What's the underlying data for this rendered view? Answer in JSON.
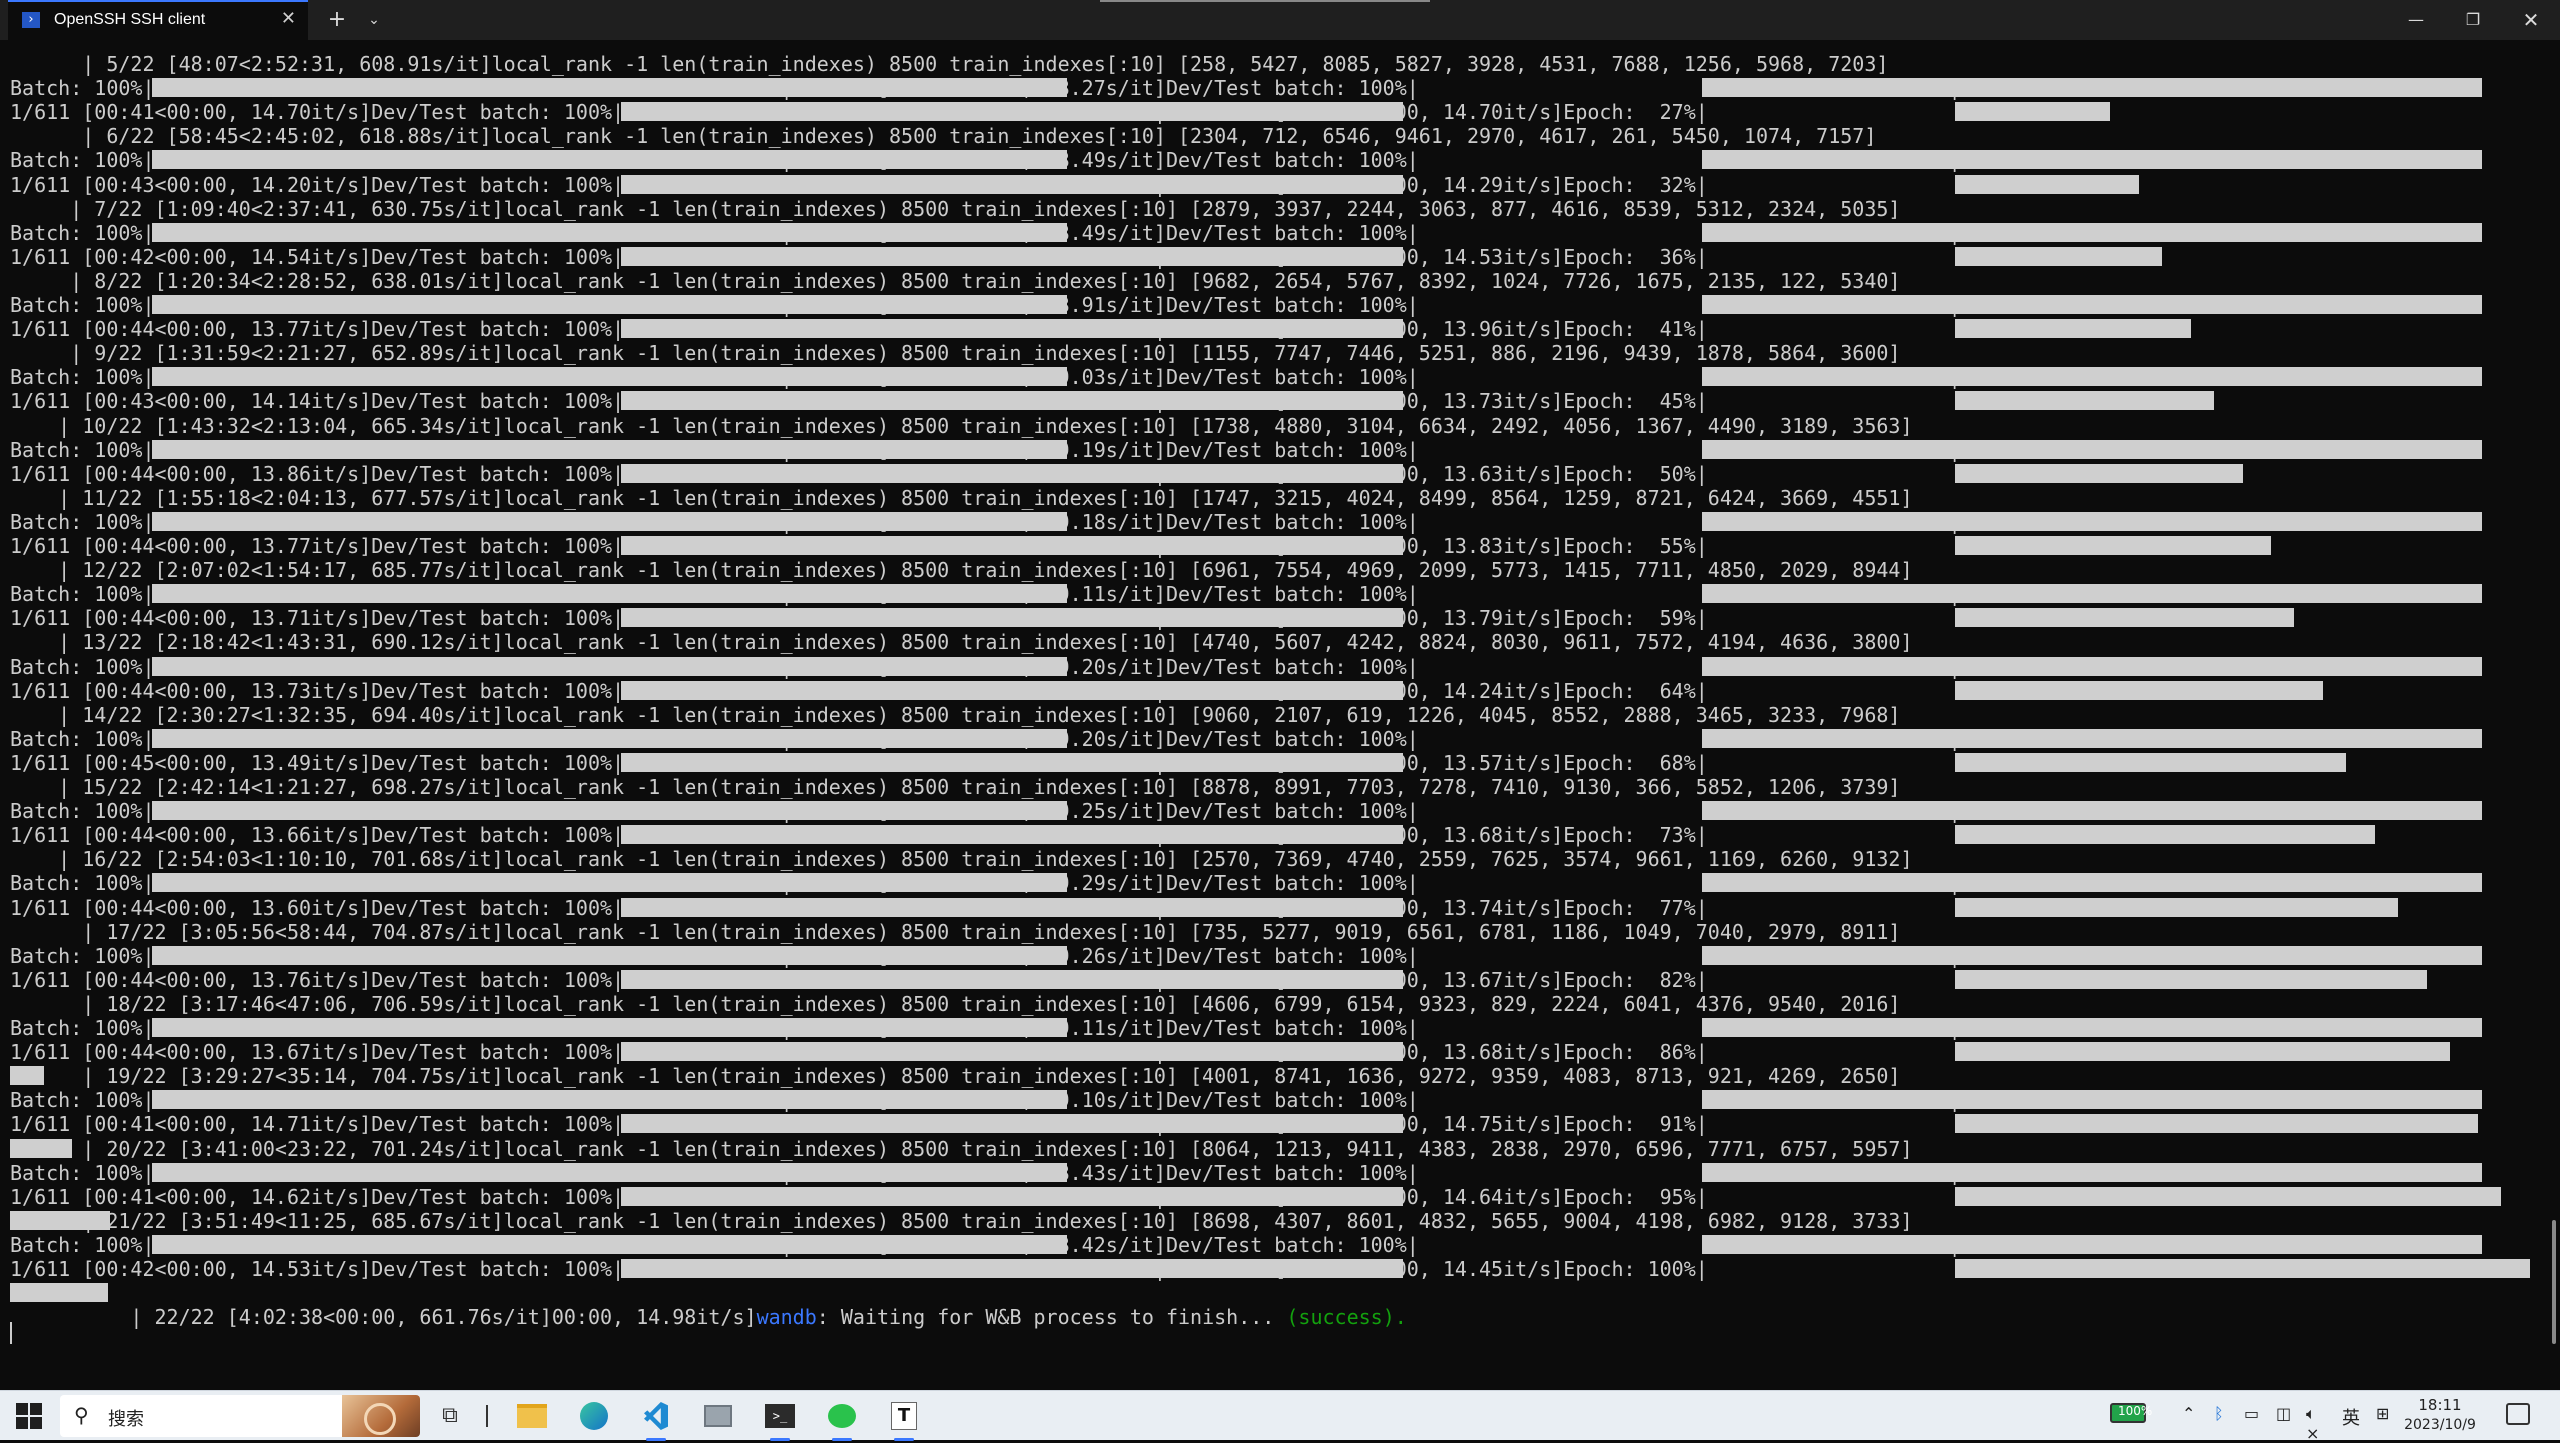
{
  "window": {
    "tab_title": "OpenSSH SSH client",
    "tab_icon": "terminal-icon",
    "new_tab": "+",
    "dropdown": "⌄",
    "minimize": "—",
    "maximize": "❐",
    "close": "✕"
  },
  "terminal": {
    "colors": {
      "text": "#cccccc",
      "background": "#0c0c0c",
      "wandb": "#3b78ff",
      "success": "#13a10e",
      "progress_fill": "#cfcfcf"
    },
    "lines": [
      "      | 5/22 [48:07<2:52:31, 608.91s/it]local_rank -1 len(train_indexes) 8500 train_indexes[:10] [258, 5427, 8085, 5827, 3928, 4531, 7688, 1256, 5968, 7203]",
      "Batch: 100%|                                                    | 67/67 [09:14<00:00,  8.27s/it]Dev/Test batch: 100%|                                            | 61",
      "1/611 [00:41<00:00, 14.70it/s]Dev/Test batch: 100%|                                            | 621/621 [00:42<00:00, 14.70it/s]Epoch:  27%|",
      "      | 6/22 [58:45<2:45:02, 618.88s/it]local_rank -1 len(train_indexes) 8500 train_indexes[:10] [2304, 712, 6546, 9461, 2970, 4617, 261, 5450, 1074, 7157]",
      "Batch: 100%|                                                    | 67/67 [09:28<00:00,  8.49s/it]Dev/Test batch: 100%|                                            | 61",
      "1/611 [00:43<00:00, 14.20it/s]Dev/Test batch: 100%|                                            | 621/621 [00:43<00:00, 14.29it/s]Epoch:  32%|",
      "     | 7/22 [1:09:40<2:37:41, 630.75s/it]local_rank -1 len(train_indexes) 8500 train_indexes[:10] [2879, 3937, 2244, 3063, 877, 4616, 8539, 5312, 2324, 5035]",
      "Batch: 100%|                                                    | 67/67 [09:28<00:00,  8.49s/it]Dev/Test batch: 100%|                                            | 61",
      "1/611 [00:42<00:00, 14.54it/s]Dev/Test batch: 100%|                                            | 621/621 [00:42<00:00, 14.53it/s]Epoch:  36%|",
      "     | 8/22 [1:20:34<2:28:52, 638.01s/it]local_rank -1 len(train_indexes) 8500 train_indexes[:10] [9682, 2654, 5767, 8392, 1024, 7726, 1675, 2135, 122, 5340]",
      "Batch: 100%|                                                    | 67/67 [09:56<00:00,  8.91s/it]Dev/Test batch: 100%|                                            | 61",
      "1/611 [00:44<00:00, 13.77it/s]Dev/Test batch: 100%|                                            | 621/621 [00:44<00:00, 13.96it/s]Epoch:  41%|",
      "     | 9/22 [1:31:59<2:21:27, 652.89s/it]local_rank -1 len(train_indexes) 8500 train_indexes[:10] [1155, 7747, 7446, 5251, 886, 2196, 9439, 1878, 5864, 3600]",
      "Batch: 100%|                                                    | 67/67 [10:04<00:00,  9.03s/it]Dev/Test batch: 100%|                                            | 61",
      "1/611 [00:43<00:00, 14.14it/s]Dev/Test batch: 100%|                                            | 621/621 [00:45<00:00, 13.73it/s]Epoch:  45%|",
      "    | 10/22 [1:43:32<2:13:04, 665.34s/it]local_rank -1 len(train_indexes) 8500 train_indexes[:10] [1738, 4880, 3104, 6634, 2492, 4056, 1367, 4490, 3189, 3563]",
      "Batch: 100%|                                                    | 67/67 [10:15<00:00,  9.19s/it]Dev/Test batch: 100%|                                            | 61",
      "1/611 [00:44<00:00, 13.86it/s]Dev/Test batch: 100%|                                            | 621/621 [00:45<00:00, 13.63it/s]Epoch:  50%|",
      "    | 11/22 [1:55:18<2:04:13, 677.57s/it]local_rank -1 len(train_indexes) 8500 train_indexes[:10] [1747, 3215, 4024, 8499, 8564, 1259, 8721, 6424, 3669, 4551]",
      "Batch: 100%|                                                    | 67/67 [10:15<00:00,  9.18s/it]Dev/Test batch: 100%|                                            | 61",
      "1/611 [00:44<00:00, 13.77it/s]Dev/Test batch: 100%|                                            | 621/621 [00:44<00:00, 13.83it/s]Epoch:  55%|",
      "    | 12/22 [2:07:02<1:54:17, 685.77s/it]local_rank -1 len(train_indexes) 8500 train_indexes[:10] [6961, 7554, 4969, 2099, 5773, 1415, 7711, 4850, 2029, 8944]",
      "Batch: 100%|                                                    | 67/67 [10:10<00:00,  9.11s/it]Dev/Test batch: 100%|                                            | 61",
      "1/611 [00:44<00:00, 13.71it/s]Dev/Test batch: 100%|                                            | 621/621 [00:45<00:00, 13.79it/s]Epoch:  59%|",
      "    | 13/22 [2:18:42<1:43:31, 690.12s/it]local_rank -1 len(train_indexes) 8500 train_indexes[:10] [4740, 5607, 4242, 8824, 8030, 9611, 7572, 4194, 4636, 3800]",
      "Batch: 100%|                                                    | 67/67 [10:16<00:00,  9.20s/it]Dev/Test batch: 100%|                                            | 61",
      "1/611 [00:44<00:00, 13.73it/s]Dev/Test batch: 100%|                                            | 621/621 [00:43<00:00, 14.24it/s]Epoch:  64%|",
      "    | 14/22 [2:30:27<1:32:35, 694.40s/it]local_rank -1 len(train_indexes) 8500 train_indexes[:10] [9060, 2107, 619, 1226, 4045, 8552, 2888, 3465, 3233, 7968]",
      "Batch: 100%|                                                    | 67/67 [10:16<00:00,  9.20s/it]Dev/Test batch: 100%|                                            | 61",
      "1/611 [00:45<00:00, 13.49it/s]Dev/Test batch: 100%|                                            | 621/621 [00:45<00:00, 13.57it/s]Epoch:  68%|",
      "    | 15/22 [2:42:14<1:21:27, 698.27s/it]local_rank -1 len(train_indexes) 8500 train_indexes[:10] [8878, 8991, 7703, 7278, 7410, 9130, 366, 5852, 1206, 3739]",
      "Batch: 100%|                                                    | 67/67 [10:19<00:00,  9.25s/it]Dev/Test batch: 100%|                                            | 61",
      "1/611 [00:44<00:00, 13.66it/s]Dev/Test batch: 100%|                                            | 621/621 [00:45<00:00, 13.68it/s]Epoch:  73%|",
      "    | 16/22 [2:54:03<1:10:10, 701.68s/it]local_rank -1 len(train_indexes) 8500 train_indexes[:10] [2570, 7369, 4740, 2559, 7625, 3574, 9661, 1169, 6260, 9132]",
      "Batch: 100%|                                                    | 67/67 [10:22<00:00,  9.29s/it]Dev/Test batch: 100%|                                            | 61",
      "1/611 [00:44<00:00, 13.60it/s]Dev/Test batch: 100%|                                            | 621/621 [00:45<00:00, 13.74it/s]Epoch:  77%|",
      "      | 17/22 [3:05:56<58:44, 704.87s/it]local_rank -1 len(train_indexes) 8500 train_indexes[:10] [735, 5277, 9019, 6561, 6781, 1186, 1049, 7040, 2979, 8911]",
      "Batch: 100%|                                                    | 67/67 [10:20<00:00,  9.26s/it]Dev/Test batch: 100%|                                            | 61",
      "1/611 [00:44<00:00, 13.76it/s]Dev/Test batch: 100%|                                            | 621/621 [00:45<00:00, 13.67it/s]Epoch:  82%|",
      "      | 18/22 [3:17:46<47:06, 706.59s/it]local_rank -1 len(train_indexes) 8500 train_indexes[:10] [4606, 6799, 6154, 9323, 829, 2224, 6041, 4376, 9540, 2016]",
      "Batch: 100%|                                                    | 67/67 [10:10<00:00,  9.11s/it]Dev/Test batch: 100%|                                            | 61",
      "1/611 [00:44<00:00, 13.67it/s]Dev/Test batch: 100%|                                            | 621/621 [00:45<00:00, 13.68it/s]Epoch:  86%|",
      "      | 19/22 [3:29:27<35:14, 704.75s/it]local_rank -1 len(train_indexes) 8500 train_indexes[:10] [4001, 8741, 1636, 9272, 9359, 4083, 8713, 921, 4269, 2650]",
      "Batch: 100%|                                                    | 67/67 [10:09<00:00,  9.10s/it]Dev/Test batch: 100%|                                            | 61",
      "1/611 [00:41<00:00, 14.71it/s]Dev/Test batch: 100%|                                            | 621/621 [00:42<00:00, 14.75it/s]Epoch:  91%|",
      "      | 20/22 [3:41:00<23:22, 701.24s/it]local_rank -1 len(train_indexes) 8500 train_indexes[:10] [8064, 1213, 9411, 4383, 2838, 2970, 6596, 7771, 6757, 5957]",
      "Batch: 100%|                                                    | 67/67 [09:25<00:00,  8.43s/it]Dev/Test batch: 100%|                                            | 61",
      "1/611 [00:41<00:00, 14.62it/s]Dev/Test batch: 100%|                                            | 621/621 [00:42<00:00, 14.64it/s]Epoch:  95%|",
      "      | 21/22 [3:51:49<11:25, 685.67s/it]local_rank -1 len(train_indexes) 8500 train_indexes[:10] [8698, 4307, 8601, 4832, 5655, 9004, 4198, 6982, 9128, 3733]",
      "Batch: 100%|                                                    | 67/67 [09:23<00:00,  8.42s/it]Dev/Test batch: 100%|                                            | 61",
      "1/611 [00:42<00:00, 14.53it/s]Dev/Test batch: 100%|                                            | 621/621 [00:42<00:00, 14.45it/s]Epoch: 100%|",
      "      | 22/22 [4:02:38<00:00, 661.76s/it]00:00, 14.98it/s]"
    ],
    "final_wandb": "wandb",
    "final_message": ": Waiting for W&B process to finish... ",
    "final_success": "(success).",
    "epoch_progress": [
      0.27,
      0.32,
      0.36,
      0.41,
      0.45,
      0.5,
      0.55,
      0.59,
      0.64,
      0.68,
      0.73,
      0.77,
      0.82,
      0.86,
      0.91,
      0.95,
      1.0
    ]
  },
  "taskbar": {
    "search_placeholder": "搜索",
    "search_icon": "search-icon",
    "terminal_app_label": ">_",
    "typora_label": "T",
    "battery_level": "100%",
    "ime_label": "英",
    "clock_time": "18:11",
    "clock_date": "2023/10/9"
  }
}
